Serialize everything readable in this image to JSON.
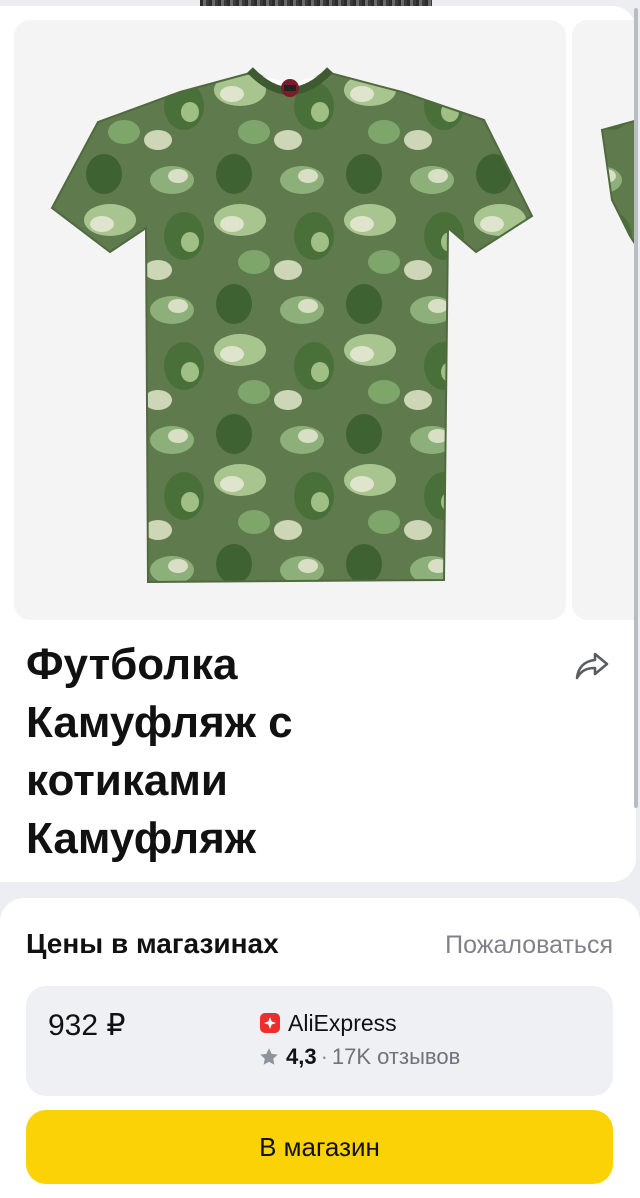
{
  "product": {
    "title": "Футболка Камуфляж с котиками Камуфляж",
    "image_alt": "Футболка Камуфляж с котиками Камуфляж"
  },
  "prices": {
    "heading": "Цены в магазинах",
    "complain_label": "Пожаловаться",
    "offer": {
      "price": "932 ₽",
      "shop_name": "AliExpress",
      "shop_color": "#ee2d2f",
      "rating": "4,3",
      "separator": "·",
      "reviews": "17K отзывов"
    },
    "store_button_label": "В магазин"
  },
  "colors": {
    "accent_button": "#fbd206",
    "offer_background": "#eef0f3",
    "shirt_base": "#5f7a4c"
  },
  "icons": {
    "share": "share-arrow-icon",
    "star": "star-icon",
    "shop_logo": "aliexpress-logo-icon"
  }
}
